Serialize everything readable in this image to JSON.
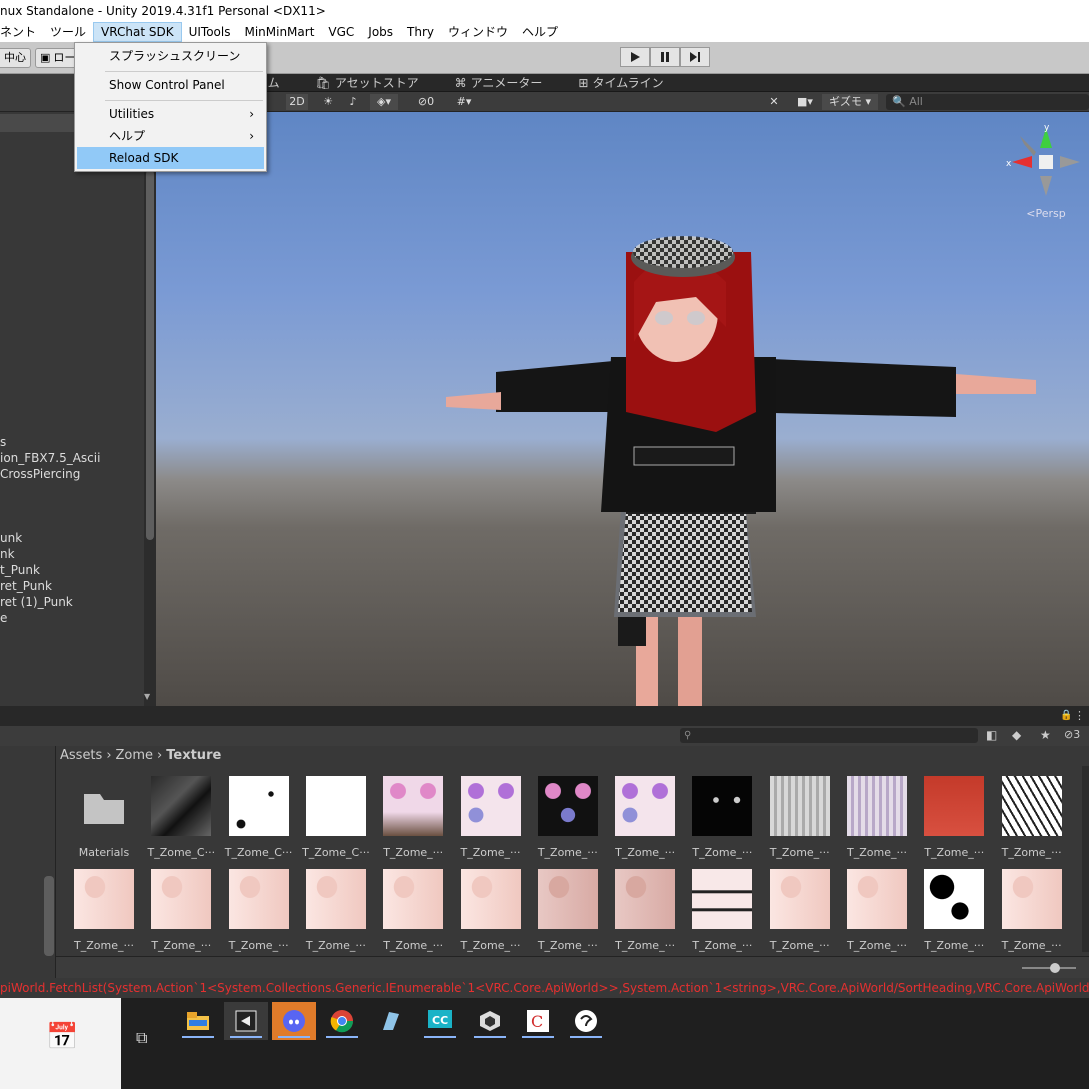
{
  "window": {
    "title": "nux Standalone - Unity 2019.4.31f1 Personal <DX11>"
  },
  "menubar": {
    "items": [
      "ネント",
      "ツール",
      "VRChat SDK",
      "UITools",
      "MinMinMart",
      "VGC",
      "Jobs",
      "Thry",
      "ウィンドウ",
      "ヘルプ"
    ]
  },
  "toolbar": {
    "pivot_label": "中心",
    "local_label": "ロー"
  },
  "dropdown": {
    "splash": "スプラッシュスクリーン",
    "control_panel": "Show Control Panel",
    "utilities": "Utilities",
    "help": "ヘルプ",
    "reload": "Reload SDK"
  },
  "scene_tabs": {
    "tab1": "ーム",
    "asset_store": "アセットストア",
    "animator": "アニメーター",
    "timeline": "タイムライン"
  },
  "scene_toolbar": {
    "mode2d": "2D",
    "hidden_count": "0",
    "gizmos": "ギズモ",
    "search_placeholder": "All",
    "persp": "<Persp"
  },
  "hierarchy": {
    "items": [
      {
        "label": "s",
        "row": 19
      },
      {
        "label": "ion_FBX7.5_Ascii",
        "row": 20
      },
      {
        "label": "CrossPiercing",
        "row": 21
      },
      {
        "label": "unk",
        "row": 25
      },
      {
        "label": "nk",
        "row": 26
      },
      {
        "label": "t_Punk",
        "row": 27
      },
      {
        "label": "ret_Punk",
        "row": 28
      },
      {
        "label": "ret (1)_Punk",
        "row": 29
      },
      {
        "label": "e",
        "row": 30
      }
    ]
  },
  "project": {
    "breadcrumb": [
      "Assets",
      "Zome",
      "Texture"
    ],
    "hidden_count": "3",
    "row1": [
      {
        "label": "Materials",
        "kind": "folder"
      },
      {
        "label": "T_Zome_C···",
        "kind": "dark"
      },
      {
        "label": "T_Zome_C···",
        "kind": "white-spots"
      },
      {
        "label": "T_Zome_C···",
        "kind": "white"
      },
      {
        "label": "T_Zome_···",
        "kind": "face-dark"
      },
      {
        "label": "T_Zome_···",
        "kind": "face"
      },
      {
        "label": "T_Zome_···",
        "kind": "face-black"
      },
      {
        "label": "T_Zome_···",
        "kind": "face"
      },
      {
        "label": "T_Zome_···",
        "kind": "black-crown"
      },
      {
        "label": "T_Zome_···",
        "kind": "silver"
      },
      {
        "label": "T_Zome_···",
        "kind": "silver-pink"
      },
      {
        "label": "T_Zome_···",
        "kind": "red"
      },
      {
        "label": "T_Zome_···",
        "kind": "bw"
      }
    ],
    "row2": [
      {
        "label": "T_Zome_···",
        "kind": "skin"
      },
      {
        "label": "T_Zome_···",
        "kind": "skin"
      },
      {
        "label": "T_Zome_···",
        "kind": "skin"
      },
      {
        "label": "T_Zome_···",
        "kind": "skin"
      },
      {
        "label": "T_Zome_···",
        "kind": "skin"
      },
      {
        "label": "T_Zome_···",
        "kind": "skin"
      },
      {
        "label": "T_Zome_···",
        "kind": "skin-dark"
      },
      {
        "label": "T_Zome_···",
        "kind": "skin-dark"
      },
      {
        "label": "T_Zome_···",
        "kind": "skin-outfit"
      },
      {
        "label": "T_Zome_···",
        "kind": "skin"
      },
      {
        "label": "T_Zome_···",
        "kind": "skin"
      },
      {
        "label": "T_Zome_···",
        "kind": "mask"
      },
      {
        "label": "T_Zome_···",
        "kind": "skin"
      }
    ]
  },
  "console": {
    "message": "piWorld.FetchList(System.Action`1<System.Collections.Generic.IEnumerable`1<VRC.Core.ApiWorld>>,System.Action`1<string>,VRC.Core.ApiWorld/SortHeading,VRC.Core.ApiWorld/Sor"
  },
  "colors": {
    "menu_highlight": "#91c9f7",
    "console_error": "#e53030",
    "scene_sky": "#6f92cc"
  }
}
